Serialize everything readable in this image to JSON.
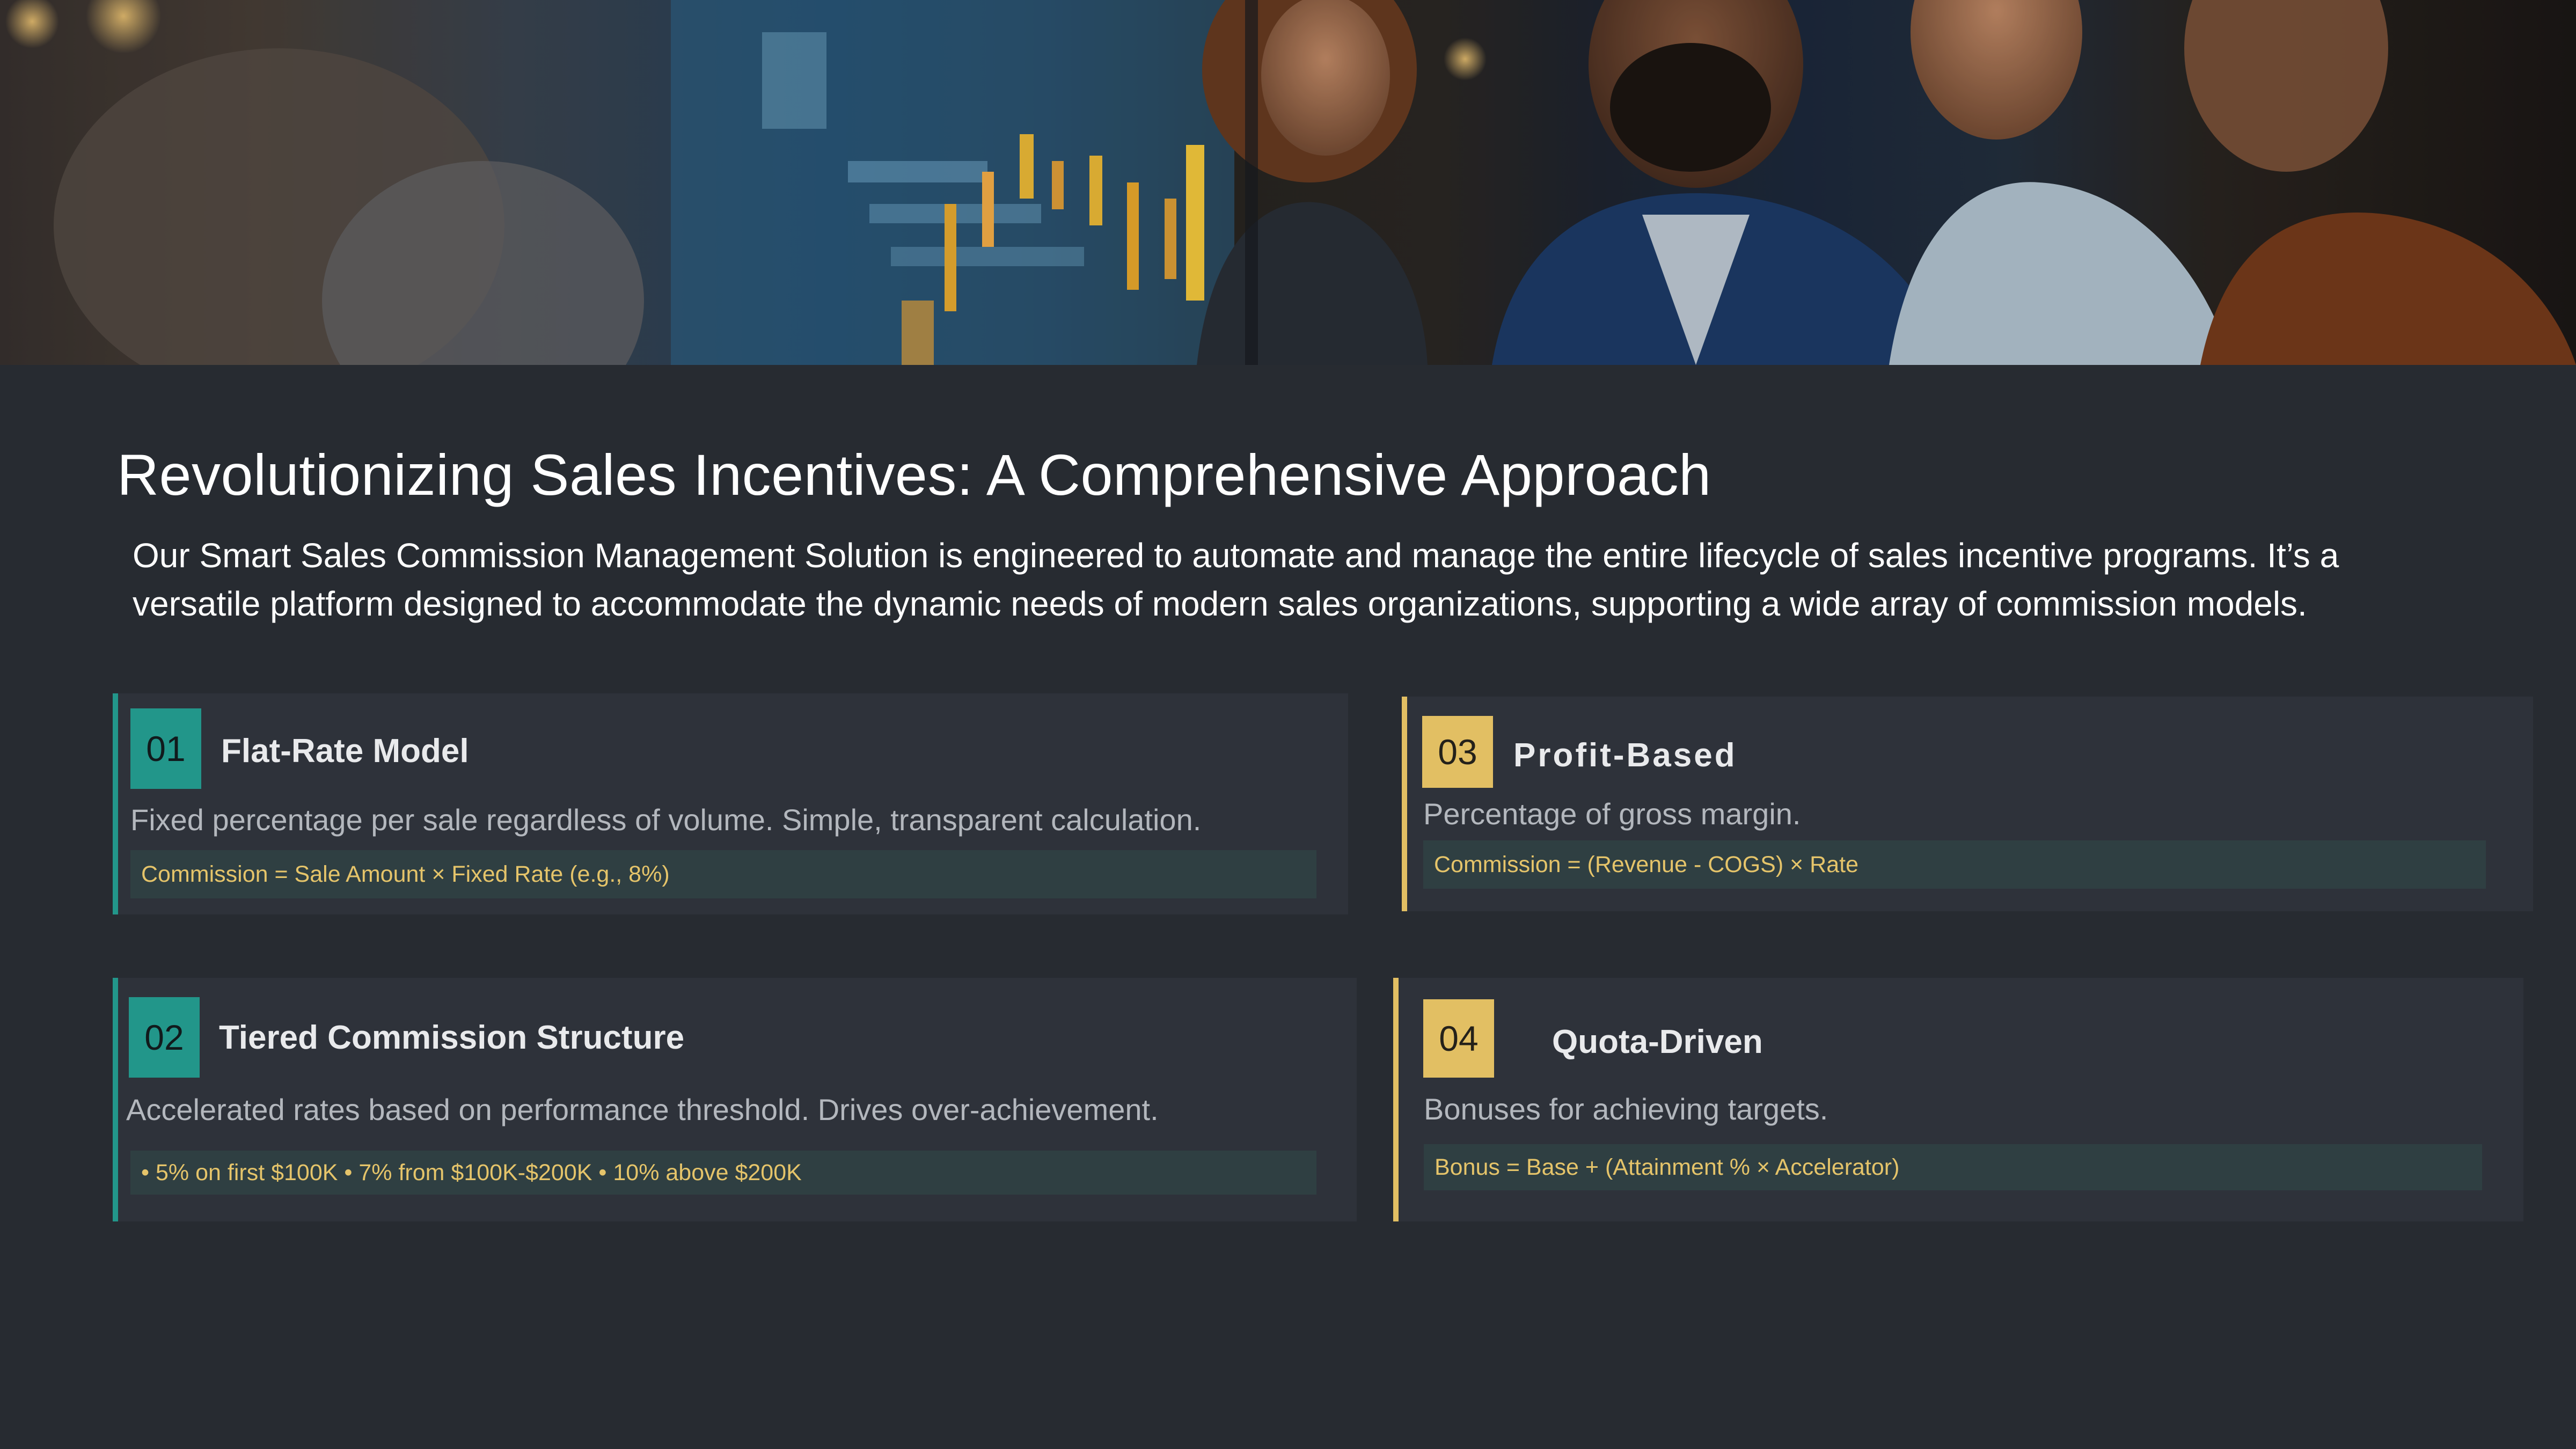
{
  "title": "Revolutionizing Sales Incentives: A Comprehensive Approach",
  "intro": "Our Smart Sales Commission Management Solution is engineered to automate and manage the entire lifecycle of sales incentive programs. It’s a versatile platform designed to accommodate the dynamic needs of modern sales organizations, supporting a wide array of commission models.",
  "colors": {
    "background": "#272b31",
    "card": "#2e323a",
    "teal_accent": "#22968a",
    "gold_accent": "#e2bf63",
    "formula_bg": "#2f3f42",
    "formula_text": "#e5c46a"
  },
  "cards": [
    {
      "number": "01",
      "title": "Flat-Rate Model",
      "description": "Fixed percentage per sale regardless of volume. Simple, transparent calculation.",
      "formula": "Commission = Sale Amount × Fixed Rate (e.g., 8%)"
    },
    {
      "number": "02",
      "title": "Tiered Commission Structure",
      "description": "Accelerated rates based on performance threshold. Drives over-achievement.",
      "formula": "• 5% on first $100K • 7% from $100K-$200K • 10% above $200K"
    },
    {
      "number": "03",
      "title": "Profit-Based",
      "description": "Percentage of gross margin.",
      "formula": "Commission = (Revenue - COGS) × Rate"
    },
    {
      "number": "04",
      "title": "Quota-Driven",
      "description": "Bonuses for achieving targets.",
      "formula": "Bonus = Base + (Attainment % × Accelerator)"
    }
  ]
}
